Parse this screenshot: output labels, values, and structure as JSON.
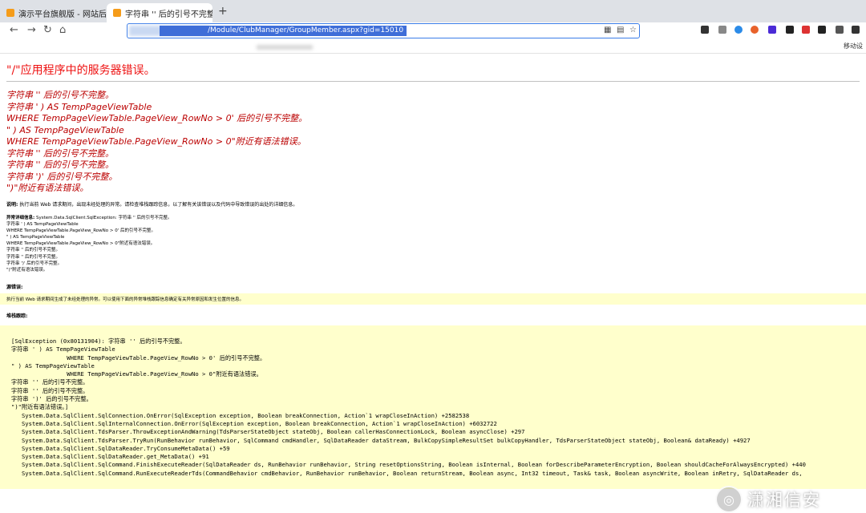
{
  "tabs": [
    {
      "title": "演示平台旗舰版 - 网站后台管理"
    },
    {
      "title": "字符串 '' 后的引号不完整。<br/>"
    }
  ],
  "toolbar": {
    "url": "/Module/ClubManager/GroupMember.aspx?gid=15010",
    "back_icon": "←",
    "forward_icon": "→",
    "reload_icon": "↻",
    "home_icon": "⌂"
  },
  "bookmarks": {
    "mobile": "移动设"
  },
  "page": {
    "h1": "\"/\"应用程序中的服务器错误。",
    "h2_lines": [
      "字符串 '' 后的引号不完整。",
      "字符串 ' ) AS TempPageViewTable",
      "WHERE TempPageViewTable.PageView_RowNo > 0' 后的引号不完整。",
      "\" ) AS TempPageViewTable",
      "WHERE TempPageViewTable.PageView_RowNo > 0\"附近有语法错误。",
      "字符串 '' 后的引号不完整。",
      "字符串 '' 后的引号不完整。",
      "字符串 ')' 后的引号不完整。",
      "\")\"附近有语法错误。"
    ],
    "desc_label": "说明:",
    "desc_text": "执行当前 Web 请求期间，出现未经处理的异常。请检查堆栈跟踪信息，以了解有关该错误以及代码中导致错误的出处的详细信息。",
    "exc_label": "异常详细信息:",
    "exc_text": "System.Data.SqlClient.SqlException: 字符串 '' 后的引号不完整。\n字符串 ' ) AS TempPageViewTable\nWHERE TempPageViewTable.PageView_RowNo > 0' 后的引号不完整。\n\" ) AS TempPageViewTable\nWHERE TempPageViewTable.PageView_RowNo > 0\"附近有语法错误。\n字符串 '' 后的引号不完整。\n字符串 '' 后的引号不完整。\n字符串 ')' 后的引号不完整。\n\")\"附近有语法错误。",
    "src_label": "源错误:",
    "src_text": "执行当前 Web 请求期间生成了未经处理的异常。可以使用下面的异常堆栈跟踪信息确定有关异常原因和发生位置的信息。",
    "stack_label": "堆栈跟踪:",
    "stack_lines": "[SqlException (0x80131904): 字符串 '' 后的引号不完整。\n字符串 ' ) AS TempPageViewTable\n                WHERE TempPageViewTable.PageView_RowNo > 0' 后的引号不完整。\n\" ) AS TempPageViewTable\n                WHERE TempPageViewTable.PageView_RowNo > 0\"附近有语法错误。\n字符串 '' 后的引号不完整。\n字符串 '' 后的引号不完整。\n字符串 ')' 后的引号不完整。\n\")\"附近有语法错误。]\n   System.Data.SqlClient.SqlConnection.OnError(SqlException exception, Boolean breakConnection, Action`1 wrapCloseInAction) +2582538\n   System.Data.SqlClient.SqlInternalConnection.OnError(SqlException exception, Boolean breakConnection, Action`1 wrapCloseInAction) +6032722\n   System.Data.SqlClient.TdsParser.ThrowExceptionAndWarning(TdsParserStateObject stateObj, Boolean callerHasConnectionLock, Boolean asyncClose) +297\n   System.Data.SqlClient.TdsParser.TryRun(RunBehavior runBehavior, SqlCommand cmdHandler, SqlDataReader dataStream, BulkCopySimpleResultSet bulkCopyHandler, TdsParserStateObject stateObj, Boolean& dataReady) +4927\n   System.Data.SqlClient.SqlDataReader.TryConsumeMetaData() +59\n   System.Data.SqlClient.SqlDataReader.get_MetaData() +91\n   System.Data.SqlClient.SqlCommand.FinishExecuteReader(SqlDataReader ds, RunBehavior runBehavior, String resetOptionsString, Boolean isInternal, Boolean forDescribeParameterEncryption, Boolean shouldCacheForAlwaysEncrypted) +440\n   System.Data.SqlClient.SqlCommand.RunExecuteReaderTds(CommandBehavior cmdBehavior, RunBehavior runBehavior, Boolean returnStream, Boolean async, Int32 timeout, Task& task, Boolean asyncWrite, Boolean inRetry, SqlDataReader ds,"
  },
  "watermark": {
    "text": "潇湘信安"
  }
}
